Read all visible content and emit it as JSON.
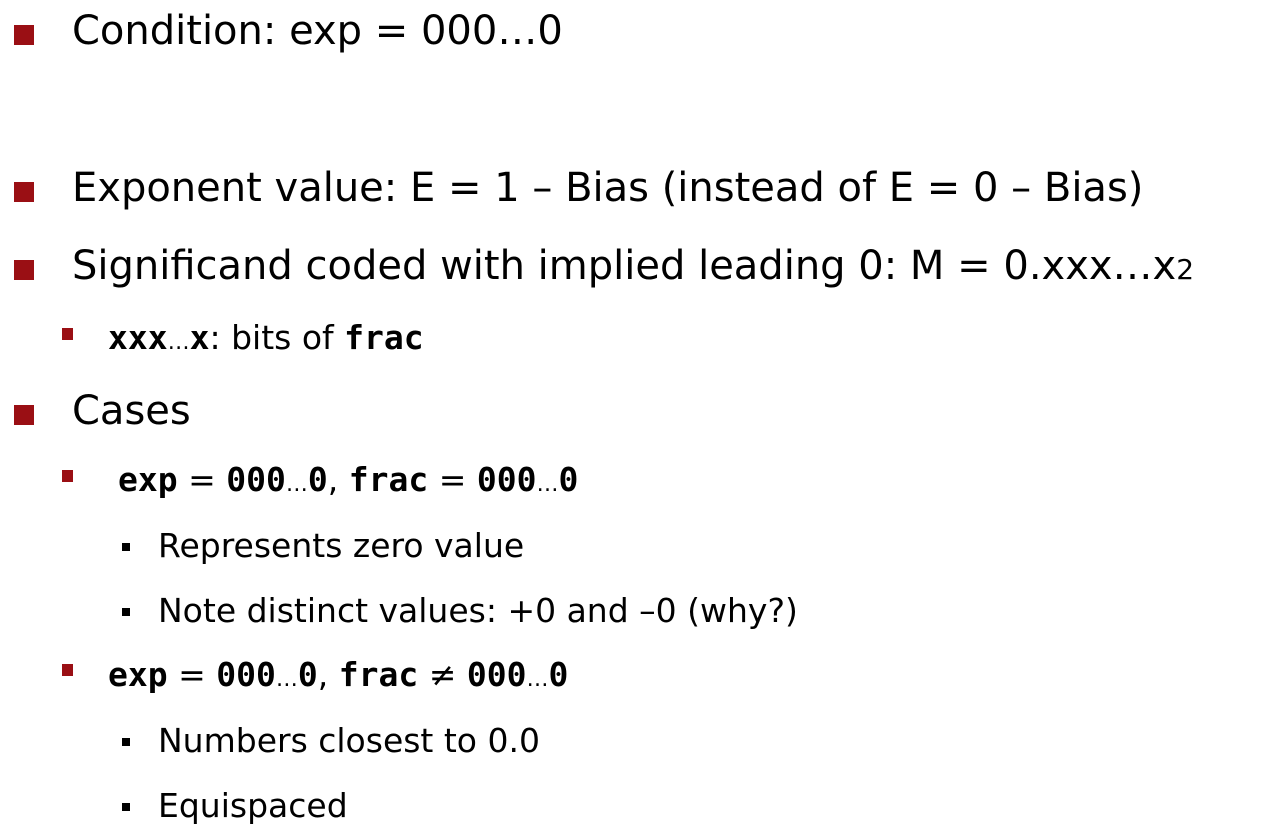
{
  "colors": {
    "bullet_level1": "#9a0f14",
    "bullet_level2": "#9a0f14",
    "bullet_level3": "#000000",
    "text": "#000000"
  },
  "condition": {
    "text": "Condition: exp = 000…0"
  },
  "exponent": {
    "text": "Exponent value: E = 1 – Bias (instead of E = 0 – Bias)"
  },
  "significand": {
    "text": "Significand coded with implied leading 0: M = 0.xxx…x",
    "subscript": "2",
    "sub_item": {
      "code_bits": "xxx",
      "ellipsis": "…",
      "code_x": "x",
      "text": ": bits of ",
      "code_frac": "frac"
    }
  },
  "cases": {
    "label": "Cases",
    "case1": {
      "code_exp": "exp",
      "eq1": " = ",
      "val1a": "000",
      "ellipsis1": "…",
      "val1b": "0",
      "comma": ", ",
      "code_frac": "frac",
      "eq2": " = ",
      "val2a": "000",
      "ellipsis2": "…",
      "val2b": "0",
      "items": [
        "Represents zero value",
        "Note distinct values: +0 and –0 (why?)"
      ]
    },
    "case2": {
      "code_exp": "exp",
      "eq1": " = ",
      "val1a": "000",
      "ellipsis1": "…",
      "val1b": "0",
      "comma": ", ",
      "code_frac": "frac",
      "neq": " ≠ ",
      "val2a": "000",
      "ellipsis2": "…",
      "val2b": "0",
      "items": [
        "Numbers closest to 0.0",
        "Equispaced"
      ]
    }
  }
}
